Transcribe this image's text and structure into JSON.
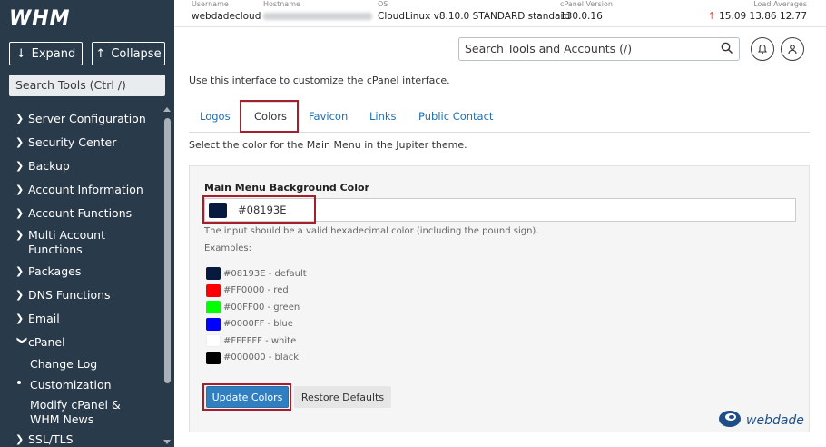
{
  "sidebar": {
    "logo": "WHM",
    "expand_label": "Expand",
    "collapse_label": "Collapse",
    "search_placeholder": "Search Tools (Ctrl /)",
    "items": [
      {
        "label": "Server Configuration"
      },
      {
        "label": "Security Center"
      },
      {
        "label": "Backup"
      },
      {
        "label": "Account Information"
      },
      {
        "label": "Account Functions"
      },
      {
        "label": "Multi Account Functions"
      },
      {
        "label": "Packages"
      },
      {
        "label": "DNS Functions"
      },
      {
        "label": "Email"
      },
      {
        "label": "cPanel"
      }
    ],
    "sub_items": [
      {
        "label": "Change Log"
      },
      {
        "label": "Customization"
      },
      {
        "label": "Modify cPanel & WHM News"
      }
    ],
    "partial_item": "SSL/TLS"
  },
  "header": {
    "username_key": "Username",
    "username": "webdadecloud",
    "hostname_key": "Hostname",
    "os_key": "OS",
    "os": "CloudLinux v8.10.0 STANDARD standard",
    "cpanel_key": "cPanel Version",
    "cpanel_version": "130.0.16",
    "load_key": "Load Averages",
    "load_1": "15.09",
    "load_2": "13.86",
    "load_3": "12.77",
    "search_placeholder": "Search Tools and Accounts (/)"
  },
  "content": {
    "intro": "Use this interface to customize the cPanel interface.",
    "tabs": [
      "Logos",
      "Colors",
      "Favicon",
      "Links",
      "Public Contact"
    ],
    "active_tab": "Colors",
    "tab_description": "Select the color for the Main Menu in the Jupiter theme.",
    "field_label": "Main Menu Background Color",
    "field_value": "#08193E",
    "field_help": "The input should be a valid hexadecimal color (including the pound sign).",
    "examples_label": "Examples:",
    "examples": [
      {
        "color": "#08193E",
        "label": "#08193E - default"
      },
      {
        "color": "#FF0000",
        "label": "#FF0000 - red"
      },
      {
        "color": "#00FF00",
        "label": "#00FF00 - green"
      },
      {
        "color": "#0000FF",
        "label": "#0000FF - blue"
      },
      {
        "color": "#FFFFFF",
        "label": "#FFFFFF - white"
      },
      {
        "color": "#000000",
        "label": "#000000 - black"
      }
    ],
    "update_label": "Update Colors",
    "restore_label": "Restore Defaults"
  },
  "watermark": "webdade",
  "colors": {
    "sidebar_bg": "#293a4a",
    "accent": "#2f7fc1",
    "highlight": "#a31f2c",
    "link": "#1f6fb2"
  }
}
